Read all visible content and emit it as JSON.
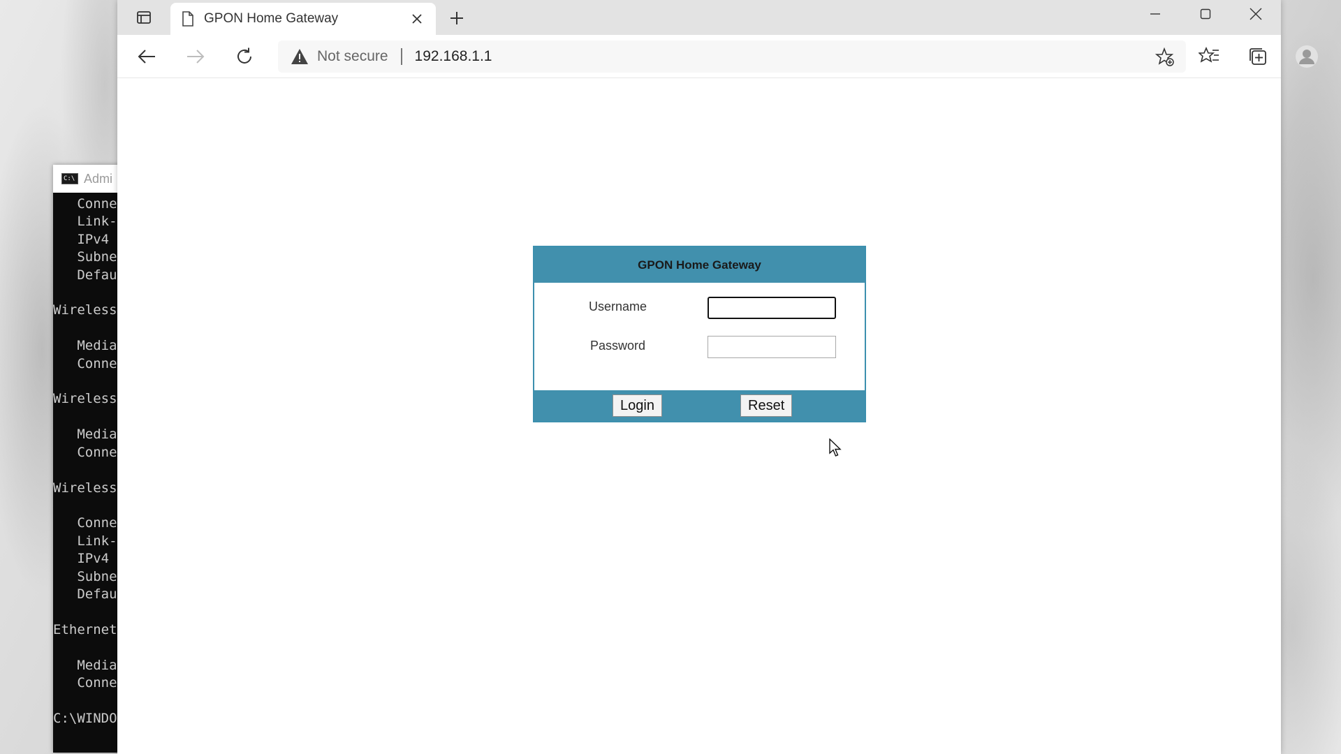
{
  "terminal": {
    "title": "Admi",
    "lines": [
      "   Conne",
      "   Link-",
      "   IPv4 ",
      "   Subne",
      "   Defau",
      "",
      "Wireless",
      "",
      "   Media",
      "   Conne",
      "",
      "Wireless",
      "",
      "   Media",
      "   Conne",
      "",
      "Wireless",
      "",
      "   Conne",
      "   Link-",
      "   IPv4 ",
      "   Subne",
      "   Defau",
      "",
      "Ethernet",
      "",
      "   Media",
      "   Conne",
      "",
      "C:\\WINDO"
    ]
  },
  "browser": {
    "tab": {
      "title": "GPON Home Gateway"
    },
    "address": {
      "security_label": "Not secure",
      "url": "192.168.1.1"
    }
  },
  "login": {
    "title": "GPON Home Gateway",
    "username_label": "Username",
    "username_value": "",
    "password_label": "Password",
    "password_value": "",
    "login_button": "Login",
    "reset_button": "Reset"
  },
  "colors": {
    "panel_accent": "#4190ad"
  }
}
